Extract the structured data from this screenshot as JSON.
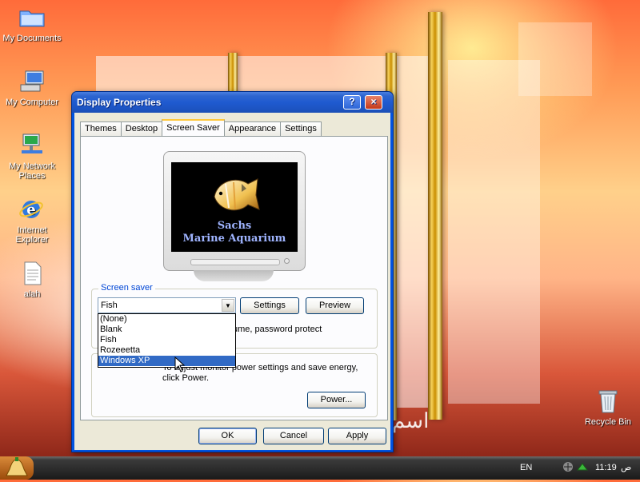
{
  "desktop": {
    "icons": [
      {
        "label": "My Documents",
        "icon": "folder-icon"
      },
      {
        "label": "My Computer",
        "icon": "computer-icon"
      },
      {
        "label": "My Network Places",
        "icon": "network-icon"
      },
      {
        "label": "Internet Explorer",
        "icon": "ie-icon"
      },
      {
        "label": "alah",
        "icon": "text-file-icon"
      },
      {
        "label": "Recycle Bin",
        "icon": "recycle-bin-icon"
      }
    ],
    "wallpaper_text": "اسم"
  },
  "dialog": {
    "title": "Display Properties",
    "help_glyph": "?",
    "close_glyph": "×",
    "tabs": [
      "Themes",
      "Desktop",
      "Screen Saver",
      "Appearance",
      "Settings"
    ],
    "active_tab": "Screen Saver",
    "preview": {
      "line1": "Sachs",
      "line2": "Marine Aquarium"
    },
    "screen_saver_group": {
      "label": "Screen saver",
      "selected": "Fish",
      "settings_button": "Settings",
      "preview_button": "Preview",
      "on_resume_text": "ume, password protect"
    },
    "dropdown_options": [
      "(None)",
      "Blank",
      "Fish",
      "Rozeeetta",
      "Windows XP"
    ],
    "highlighted_option": "Windows XP",
    "power_group": {
      "text": "To adjust monitor power settings and save energy,",
      "text2": "click Power.",
      "power_button": "Power..."
    },
    "buttons": {
      "ok": "OK",
      "cancel": "Cancel",
      "apply": "Apply"
    }
  },
  "taskbar": {
    "language": "EN",
    "clock": "11:19",
    "ampm": "ص"
  },
  "colors": {
    "titlebar": "#1f5ad0",
    "selection": "#316ac5",
    "group_label": "#0046d5"
  }
}
